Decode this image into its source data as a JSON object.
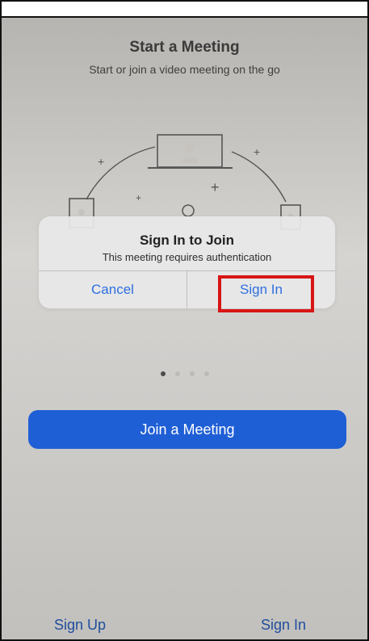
{
  "header": {
    "title": "Start a Meeting",
    "subtitle": "Start or join a video meeting on the go"
  },
  "dialog": {
    "title": "Sign In to Join",
    "message": "This meeting requires authentication",
    "cancel_label": "Cancel",
    "signin_label": "Sign In"
  },
  "pager": {
    "count": 4,
    "active_index": 0
  },
  "primary": {
    "join_label": "Join a Meeting"
  },
  "bottom": {
    "signup_label": "Sign Up",
    "signin_label": "Sign In"
  },
  "colors": {
    "accent_blue": "#1f5fd6",
    "link_blue": "#2f6fe0",
    "highlight_red": "#d81515"
  }
}
